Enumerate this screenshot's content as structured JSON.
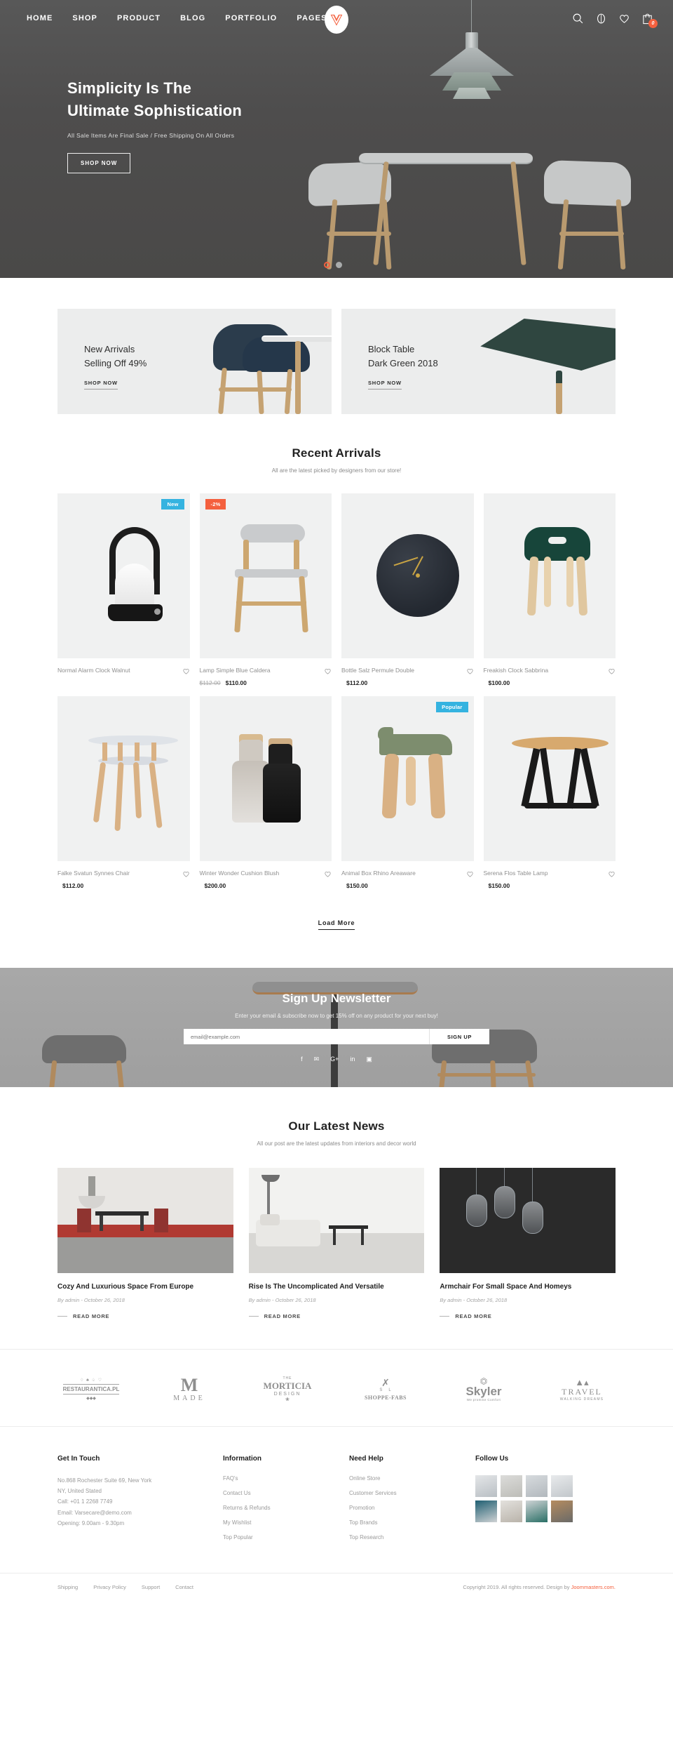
{
  "header": {
    "nav": [
      {
        "label": "HOME"
      },
      {
        "label": "SHOP"
      },
      {
        "label": "PRODUCT"
      },
      {
        "label": "BLOG"
      },
      {
        "label": "PORTFOLIO"
      },
      {
        "label": "PAGES"
      }
    ],
    "logo_alt": "V",
    "icons": [
      {
        "name": "search-icon"
      },
      {
        "name": "user-account-icon"
      },
      {
        "name": "wishlist-heart-icon"
      },
      {
        "name": "cart-icon"
      }
    ],
    "cart_count": "0",
    "accent_color": "#f4603e"
  },
  "hero": {
    "title_line1": "Simplicity Is The",
    "title_line2": "Ultimate Sophistication",
    "subtitle": "All Sale Items Are Final Sale / Free Shipping On All Orders",
    "cta": "SHOP NOW",
    "dots": [
      "active",
      "idle"
    ]
  },
  "promos": [
    {
      "title_line1": "New Arrivals",
      "title_line2": "Selling Off 49%",
      "cta": "SHOP NOW"
    },
    {
      "title_line1": "Block Table",
      "title_line2": "Dark Green 2018",
      "cta": "SHOP NOW"
    }
  ],
  "recent_arrivals": {
    "title": "Recent Arrivals",
    "subtitle": "All are the latest picked by designers from our store!",
    "load_more": "Load More",
    "products": [
      {
        "name": "Normal Alarm Clock Walnut",
        "price": "",
        "old_price": "",
        "badge": "New",
        "badge_type": "new"
      },
      {
        "name": "Lamp Simple Blue Caldera",
        "price": "$110.00",
        "old_price": "$112.00",
        "badge": "-2%",
        "badge_type": "sale"
      },
      {
        "name": "Bottle Salz Permule Double",
        "price": "$112.00",
        "old_price": "",
        "badge": "",
        "badge_type": ""
      },
      {
        "name": "Freakish Clock Sabbrina",
        "price": "$100.00",
        "old_price": "",
        "badge": "",
        "badge_type": ""
      },
      {
        "name": "Falke Svatun Synnes Chair",
        "price": "$112.00",
        "old_price": "",
        "badge": "",
        "badge_type": ""
      },
      {
        "name": "Winter Wonder Cushion Blush",
        "price": "$200.00",
        "old_price": "",
        "badge": "",
        "badge_type": ""
      },
      {
        "name": "Animal Box Rhino Areaware",
        "price": "$150.00",
        "old_price": "",
        "badge": "Popular",
        "badge_type": "popular"
      },
      {
        "name": "Serena Flos Table Lamp",
        "price": "$150.00",
        "old_price": "",
        "badge": "",
        "badge_type": ""
      }
    ]
  },
  "newsletter": {
    "title": "Sign Up Newsletter",
    "subtitle": "Enter your email & subscribe now to get 15% off on any product for your next buy!",
    "placeholder": "email@example.com",
    "button": "SIGN UP",
    "social": [
      {
        "name": "facebook-icon",
        "glyph": "f"
      },
      {
        "name": "twitter-icon",
        "glyph": "✉"
      },
      {
        "name": "google-plus-icon",
        "glyph": "G+"
      },
      {
        "name": "linkedin-icon",
        "glyph": "in"
      },
      {
        "name": "instagram-icon",
        "glyph": "▣"
      }
    ]
  },
  "news": {
    "title": "Our Latest News",
    "subtitle": "All our post are the latest updates from interiors and decor world",
    "posts": [
      {
        "title": "Cozy And Luxurious Space From Europe",
        "meta": "By admin  -  October 26, 2018",
        "read_more": "READ MORE"
      },
      {
        "title": "Rise Is The Uncomplicated And Versatile",
        "meta": "By admin  -  October 26, 2018",
        "read_more": "READ MORE"
      },
      {
        "title": "Armchair For Small Space And Homeys",
        "meta": "By admin  -  October 26, 2018",
        "read_more": "READ MORE"
      }
    ]
  },
  "brands": [
    {
      "name": "RESTAURANTICA.PL",
      "sub": ""
    },
    {
      "name": "MADE",
      "sub": ""
    },
    {
      "name": "MORTICIA",
      "sub": "DESIGN"
    },
    {
      "name": "SHOPPE-FABS",
      "sub": ""
    },
    {
      "name": "Skyler",
      "sub": "We promise Comfort"
    },
    {
      "name": "TRAVEL",
      "sub": "WALKING DREAMS"
    }
  ],
  "footer": {
    "get_in_touch": {
      "title": "Get In Touch",
      "lines": [
        "No.868 Rochester Suite 69, New York",
        "NY, United Stated",
        "Call: +01 1 2268 7749",
        "Email: Varsecare@demo.com",
        "Opening: 9.00am - 9.30pm"
      ]
    },
    "information": {
      "title": "Information",
      "links": [
        "FAQ's",
        "Contact Us",
        "Returns & Refunds",
        "My Wishlist",
        "Top Popular"
      ]
    },
    "need_help": {
      "title": "Need Help",
      "links": [
        "Online Store",
        "Customer Services",
        "Promotion",
        "Top Brands",
        "Top Research"
      ]
    },
    "follow_us": {
      "title": "Follow Us",
      "thumbs": 8
    },
    "bottom_links": [
      "Shipping",
      "Privacy Policy",
      "Support",
      "Contact"
    ],
    "copyright_prefix": "Copyright 2019. All rights reserved. Design by ",
    "copyright_link": "Joommasters.com."
  }
}
